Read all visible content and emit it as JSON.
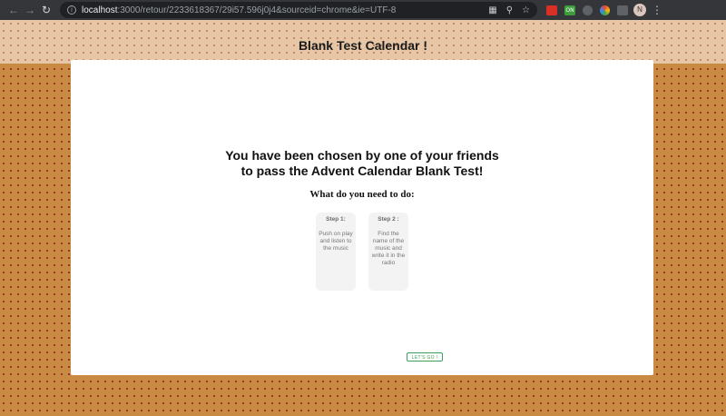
{
  "browser": {
    "url_host": "localhost",
    "url_rest": ":3000/retour/2233618367/29i57.596j0j4&sourceid=chrome&ie=UTF-8",
    "avatar_letter": "N",
    "extensions": [
      {
        "name": "red-extension-icon",
        "color": "#d93025",
        "label": ""
      },
      {
        "name": "green-extension-icon",
        "color": "#3c9d3c",
        "label": "ON"
      },
      {
        "name": "gray-extension-icon",
        "color": "#5f6368",
        "label": ""
      },
      {
        "name": "color-extension-icon",
        "color": "#1a73e8",
        "label": ""
      },
      {
        "name": "mail-extension-icon",
        "color": "#5f6368",
        "label": ""
      }
    ]
  },
  "header": {
    "title": "Blank Test Calendar !"
  },
  "intro": {
    "line1": "You have been chosen by one of your friends",
    "line2": "to pass the Advent Calendar Blank Test!",
    "subheading": "What do you need to do:"
  },
  "steps": [
    {
      "title": "Step 1:",
      "text": "Push on play and listen to the music"
    },
    {
      "title": "Step 2 :",
      "text": "Find the name of the music and write it in the radio"
    }
  ],
  "cta": {
    "label": "LET'S GO !"
  }
}
